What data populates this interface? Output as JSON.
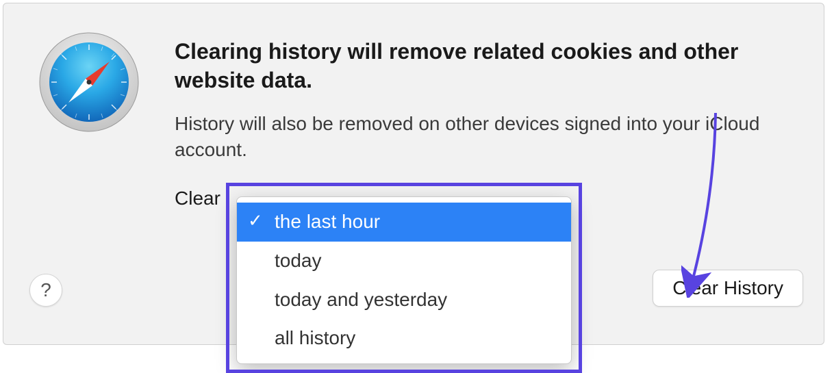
{
  "dialog": {
    "title": "Clearing history will remove related cookies and other website data.",
    "description": "History will also be removed on other devices signed into your iCloud account.",
    "clear_label": "Clear",
    "help_label": "?",
    "action_button": "Clear History"
  },
  "dropdown": {
    "options": [
      {
        "label": "the last hour",
        "selected": true
      },
      {
        "label": "today",
        "selected": false
      },
      {
        "label": "today and yesterday",
        "selected": false
      },
      {
        "label": "all history",
        "selected": false
      }
    ]
  },
  "annotation": {
    "highlight_color": "#5843e0"
  }
}
